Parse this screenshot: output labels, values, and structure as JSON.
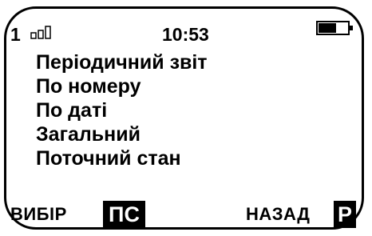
{
  "status": {
    "line_number": "1",
    "time": "10:53",
    "signal_icon": "signal-strength-icon",
    "battery_icon": "battery-icon"
  },
  "menu": {
    "items": [
      {
        "label": "Періодичний звіт"
      },
      {
        "label": "По номеру"
      },
      {
        "label": "По даті"
      },
      {
        "label": "Загальний"
      },
      {
        "label": "Поточний стан"
      }
    ]
  },
  "softkeys": {
    "left_label": "ВИБІР",
    "left_key": "ПС",
    "right_label": "НАЗАД",
    "right_key": "Р"
  }
}
